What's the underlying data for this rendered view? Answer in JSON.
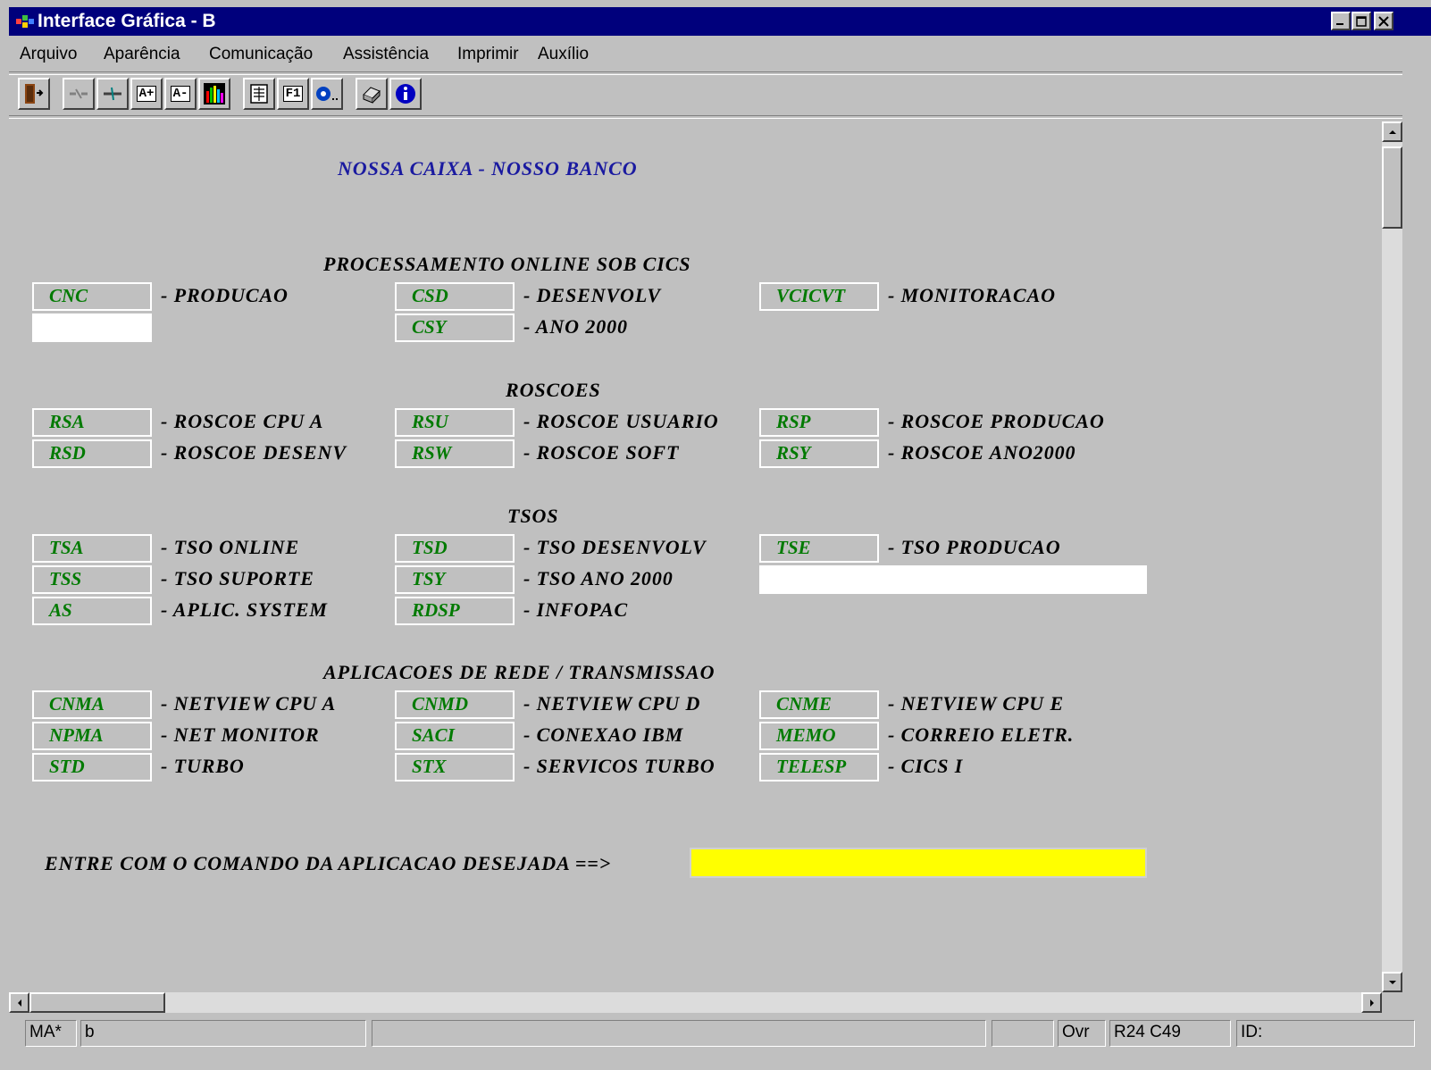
{
  "window": {
    "title": "Interface Gráfica - B",
    "controls": [
      "minimize",
      "maximize",
      "close"
    ]
  },
  "menu": {
    "items": [
      "Arquivo",
      "Aparência",
      "Comunicação",
      "Assistência",
      "Imprimir",
      "Auxílio"
    ]
  },
  "toolbar": {
    "buttons": [
      {
        "name": "door-exit-icon"
      },
      {
        "name": "disconnect-icon"
      },
      {
        "name": "connect-icon"
      },
      {
        "name": "font-increase-icon",
        "label": "A+"
      },
      {
        "name": "font-decrease-icon",
        "label": "A-"
      },
      {
        "name": "color-bars-icon"
      },
      {
        "name": "keypad-icon"
      },
      {
        "name": "function-key-icon",
        "label": "F1"
      },
      {
        "name": "record-icon"
      },
      {
        "name": "print-icon"
      },
      {
        "name": "info-icon",
        "label": "i"
      }
    ]
  },
  "screen": {
    "header": "NOSSA CAIXA - NOSSO BANCO",
    "sections": {
      "cics": {
        "title": "PROCESSAMENTO ONLINE SOB CICS",
        "rows": [
          [
            {
              "code": "CNC",
              "desc": "- PRODUCAO"
            },
            {
              "code": "CSD",
              "desc": "- DESENVOLV"
            },
            {
              "code": "VCICVT",
              "desc": "- MONITORACAO"
            }
          ],
          [
            {
              "code": "",
              "desc": ""
            },
            {
              "code": "CSY",
              "desc": "- ANO 2000"
            }
          ]
        ]
      },
      "roscoes": {
        "title": "ROSCOES",
        "rows": [
          [
            {
              "code": "RSA",
              "desc": "- ROSCOE CPU A"
            },
            {
              "code": "RSU",
              "desc": "- ROSCOE USUARIO"
            },
            {
              "code": "RSP",
              "desc": "- ROSCOE PRODUCAO"
            }
          ],
          [
            {
              "code": "RSD",
              "desc": "- ROSCOE DESENV"
            },
            {
              "code": "RSW",
              "desc": "- ROSCOE SOFT"
            },
            {
              "code": "RSY",
              "desc": "- ROSCOE ANO2000"
            }
          ]
        ]
      },
      "tsos": {
        "title": "TSOS",
        "rows": [
          [
            {
              "code": "TSA",
              "desc": "- TSO ONLINE"
            },
            {
              "code": "TSD",
              "desc": "- TSO DESENVOLV"
            },
            {
              "code": "TSE",
              "desc": "- TSO PRODUCAO"
            }
          ],
          [
            {
              "code": "TSS",
              "desc": "- TSO SUPORTE"
            },
            {
              "code": "TSY",
              "desc": "- TSO ANO 2000"
            }
          ],
          [
            {
              "code": "AS",
              "desc": "- APLIC. SYSTEM"
            },
            {
              "code": "RDSP",
              "desc": "- INFOPAC"
            }
          ]
        ]
      },
      "rede": {
        "title": "APLICACOES DE REDE / TRANSMISSAO",
        "rows": [
          [
            {
              "code": "CNMA",
              "desc": "- NETVIEW CPU A"
            },
            {
              "code": "CNMD",
              "desc": "- NETVIEW CPU D"
            },
            {
              "code": "CNME",
              "desc": "- NETVIEW CPU E"
            }
          ],
          [
            {
              "code": "NPMA",
              "desc": "- NET MONITOR"
            },
            {
              "code": "SACI",
              "desc": "- CONEXAO IBM"
            },
            {
              "code": "MEMO",
              "desc": "- CORREIO ELETR."
            }
          ],
          [
            {
              "code": "STD",
              "desc": "- TURBO"
            },
            {
              "code": "STX",
              "desc": "- SERVICOS TURBO"
            },
            {
              "code": "TELESP",
              "desc": "- CICS I"
            }
          ]
        ]
      }
    },
    "prompt": "ENTRE COM O COMANDO DA APLICACAO DESEJADA ==>",
    "command_value": ""
  },
  "status": {
    "mode": "MA*",
    "session": "b",
    "message": "",
    "blank": "",
    "insert": "Ovr",
    "cursor": "R24 C49",
    "id": "ID:"
  },
  "colors": {
    "title_bar": "#00007c",
    "window_bg": "#c0c0c0",
    "field_text": "#007a00",
    "header_text": "#1a1aa0",
    "command_field": "#ffff00"
  }
}
